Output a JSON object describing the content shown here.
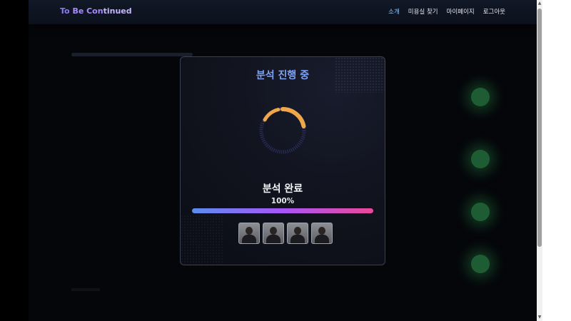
{
  "header": {
    "logo": {
      "part1": "To ",
      "part2": "Be Con",
      "part3": "tinued"
    },
    "nav": [
      {
        "label": "소개",
        "active": true
      },
      {
        "label": "미용실 찾기",
        "active": false
      },
      {
        "label": "마이페이지",
        "active": false
      },
      {
        "label": "로그아웃",
        "active": false
      }
    ]
  },
  "modal": {
    "title": "분석 진행 중",
    "status": "분석 완료",
    "percent_label": "100%",
    "progress": 1.0,
    "thumbnails": [
      {
        "kind": "face-photo"
      },
      {
        "kind": "face-photo"
      },
      {
        "kind": "face-photo"
      },
      {
        "kind": "face-photo"
      }
    ]
  },
  "colors": {
    "title": "#7da2f5",
    "spinner_arc": "#f0a74a",
    "progress_start": "#5b8def",
    "progress_mid": "#a855f7",
    "progress_end": "#ec4899"
  },
  "icons": {
    "spinner": "loading-spinner-icon",
    "scroll_up": "arrow-up-icon",
    "scroll_down": "arrow-down-icon"
  }
}
